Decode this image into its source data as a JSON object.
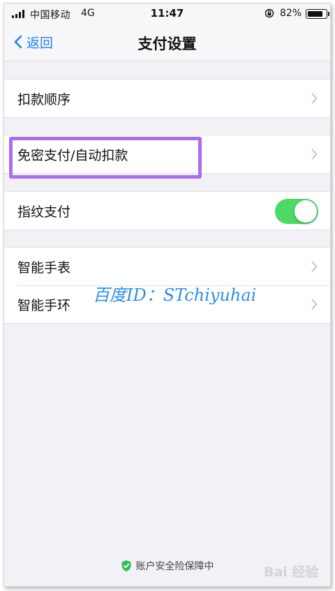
{
  "status_bar": {
    "carrier": "中国移动",
    "network": "4G",
    "time": "11:47",
    "battery_percent": "82%",
    "battery_level": 0.82
  },
  "nav": {
    "back_label": "返回",
    "title": "支付设置"
  },
  "groups": [
    {
      "items": [
        {
          "label": "扣款顺序",
          "accessory": "chevron"
        }
      ]
    },
    {
      "items": [
        {
          "label": "免密支付/自动扣款",
          "accessory": "chevron",
          "highlighted": true
        }
      ]
    },
    {
      "items": [
        {
          "label": "指纹支付",
          "accessory": "toggle",
          "toggle_on": true
        }
      ]
    },
    {
      "items": [
        {
          "label": "智能手表",
          "accessory": "chevron"
        },
        {
          "label": "智能手环",
          "accessory": "chevron"
        }
      ]
    }
  ],
  "watermark": "百度ID：STchiyuhai",
  "footer": {
    "text": "账户安全险保障中",
    "icon": "shield-check-icon"
  },
  "baidu_logo": "Bai 经验",
  "colors": {
    "accent_blue": "#1a82f8",
    "toggle_on": "#4cd964",
    "highlight_purple": "#a96ef0",
    "watermark_blue": "#2e8fe8",
    "footer_shield_green": "#2fbf55"
  }
}
